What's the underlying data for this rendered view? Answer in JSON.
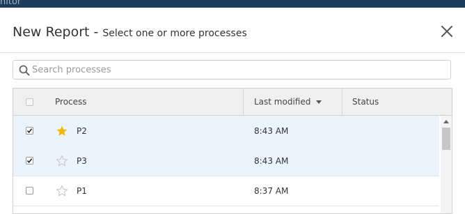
{
  "app": {
    "title_fragment": "nitor"
  },
  "dialog": {
    "title": "New Report",
    "separator": " - ",
    "subtitle": "Select one or more processes",
    "close_icon": "close-icon"
  },
  "search": {
    "placeholder": "Search processes",
    "value": "",
    "icon": "search-icon"
  },
  "table": {
    "columns": {
      "select": "",
      "process": "Process",
      "last_modified": "Last modified",
      "status": "Status"
    },
    "sort": {
      "column": "last_modified",
      "direction": "descending"
    },
    "rows": [
      {
        "name": "P2",
        "last_modified": "8:43 AM",
        "status": "",
        "checked": true,
        "starred": true
      },
      {
        "name": "P3",
        "last_modified": "8:43 AM",
        "status": "",
        "checked": true,
        "starred": false
      },
      {
        "name": "P1",
        "last_modified": "8:37 AM",
        "status": "",
        "checked": false,
        "starred": false
      }
    ]
  },
  "colors": {
    "topbar": "#1b3d5c",
    "selected_row": "#ebf4fc",
    "star_filled": "#f5b800",
    "star_empty": "#c9c9c9"
  }
}
